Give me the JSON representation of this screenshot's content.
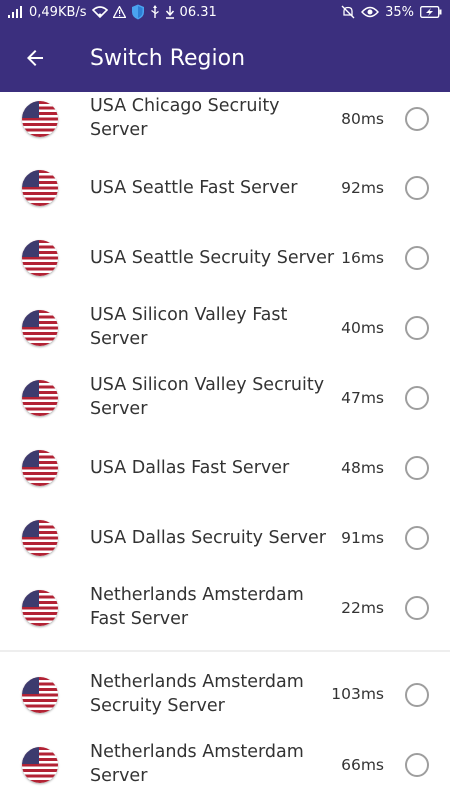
{
  "status_bar": {
    "net_speed": "0,49KB/s",
    "time": "06.31",
    "battery": "35%"
  },
  "header": {
    "title": "Switch Region",
    "back_icon": "arrow-left-icon"
  },
  "servers": [
    {
      "name": "USA Chicago Secruity Server",
      "latency": "80ms"
    },
    {
      "name": "USA Seattle Fast Server",
      "latency": "92ms"
    },
    {
      "name": "USA Seattle Secruity Server",
      "latency": "16ms"
    },
    {
      "name": "USA Silicon Valley Fast Server",
      "latency": "40ms"
    },
    {
      "name": "USA Silicon Valley Secruity Server",
      "latency": "47ms"
    },
    {
      "name": "USA Dallas Fast Server",
      "latency": "48ms"
    },
    {
      "name": "USA Dallas Secruity Server",
      "latency": "91ms"
    },
    {
      "name": "Netherlands Amsterdam Fast Server",
      "latency": "22ms"
    },
    {
      "name": "Netherlands Amsterdam Secruity Server",
      "latency": "103ms"
    },
    {
      "name": "Netherlands Amsterdam Server",
      "latency": "66ms"
    }
  ],
  "colors": {
    "primary": "#3b2f7e",
    "text": "#333333",
    "radio_border": "#9e9e9e"
  },
  "icons": {
    "flag": "us-flag-icon",
    "radio": "radio-unselected"
  }
}
